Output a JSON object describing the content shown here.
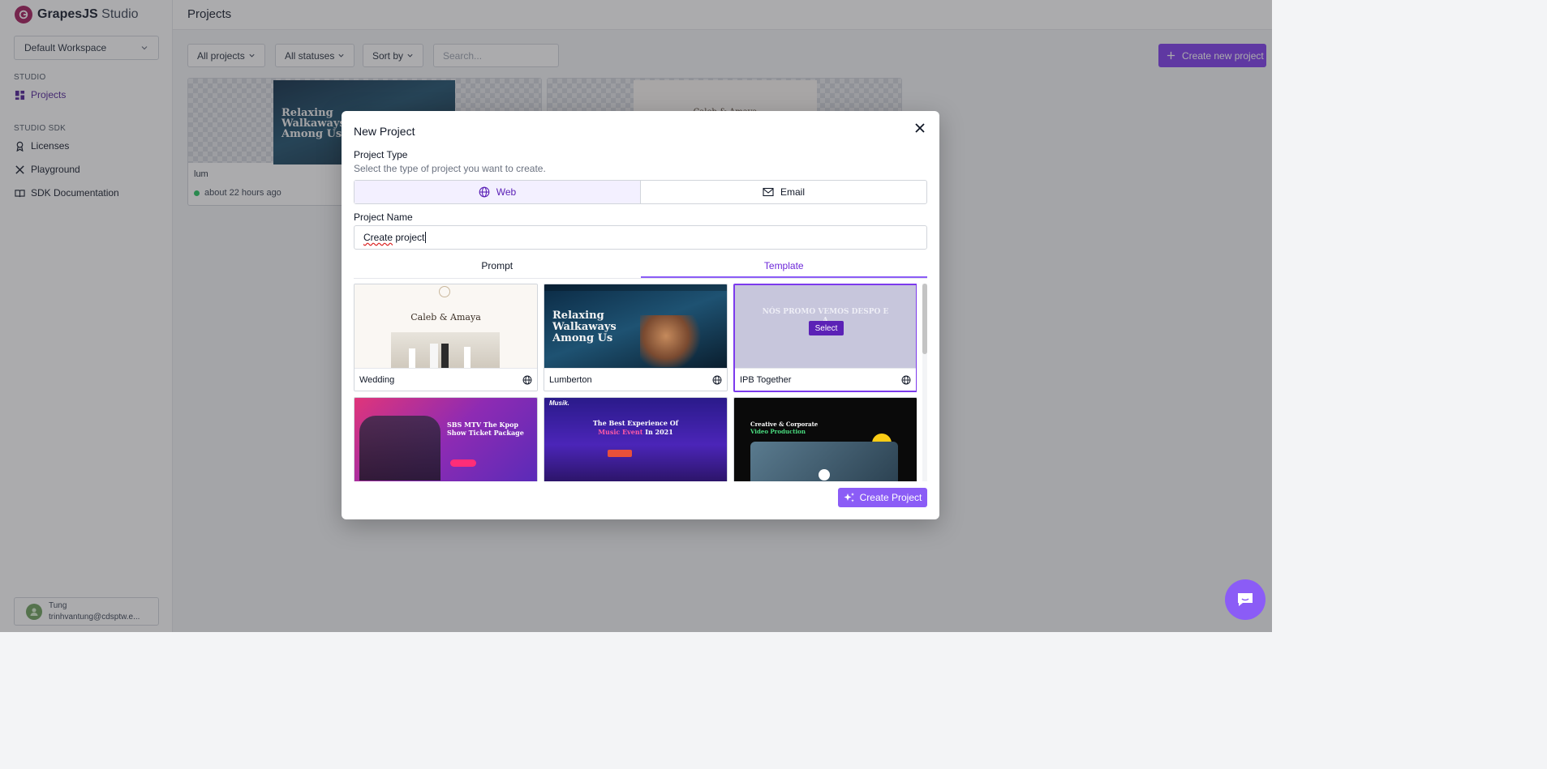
{
  "app": {
    "brand_bold": "GrapesJS",
    "brand_light": "Studio"
  },
  "sidebar": {
    "workspace": "Default Workspace",
    "studio_heading": "STUDIO",
    "projects": "Projects",
    "sdk_heading": "STUDIO SDK",
    "licenses": "Licenses",
    "playground": "Playground",
    "sdk_docs": "SDK Documentation",
    "user_name": "Tung",
    "user_email": "trinhvantung@cdsptw.e..."
  },
  "header": {
    "title": "Projects"
  },
  "filters": {
    "all_projects": "All projects",
    "all_statuses": "All statuses",
    "sort_by": "Sort by",
    "search_placeholder": "Search...",
    "create_new": "Create new project"
  },
  "projects": [
    {
      "name": "lum",
      "updated": "about 22 hours ago",
      "thumb_heading": "Relaxing Walkaways Among Us"
    },
    {
      "thumb_heading": "Caleb & Amaya"
    }
  ],
  "modal": {
    "title": "New Project",
    "type_label": "Project Type",
    "type_sub": "Select the type of project you want to create.",
    "type_web": "Web",
    "type_email": "Email",
    "name_label": "Project Name",
    "name_word1": "Create",
    "name_word2": " project",
    "tab_prompt": "Prompt",
    "tab_template": "Template",
    "select_label": "Select",
    "create_button": "Create Project",
    "templates": [
      {
        "name": "Wedding",
        "heading": "Caleb & Amaya"
      },
      {
        "name": "Lumberton",
        "heading": "Relaxing Walkaways Among Us"
      },
      {
        "name": "IPB Together",
        "heading": "NÓS PROMO VEMOS DESPO E A"
      },
      {
        "heading": "SBS MTV The Kpop Show Ticket Package"
      },
      {
        "heading_1": "The Best Experience Of",
        "heading_2": "Music Event",
        "heading_3": "In 2021",
        "logo": "Musik."
      },
      {
        "heading_1": "Creative & Corporate",
        "heading_2": "Video Production"
      }
    ]
  },
  "colors": {
    "accent": "#7c3aed",
    "accent_light": "#8b5cf6",
    "status_green": "#22c55e"
  }
}
